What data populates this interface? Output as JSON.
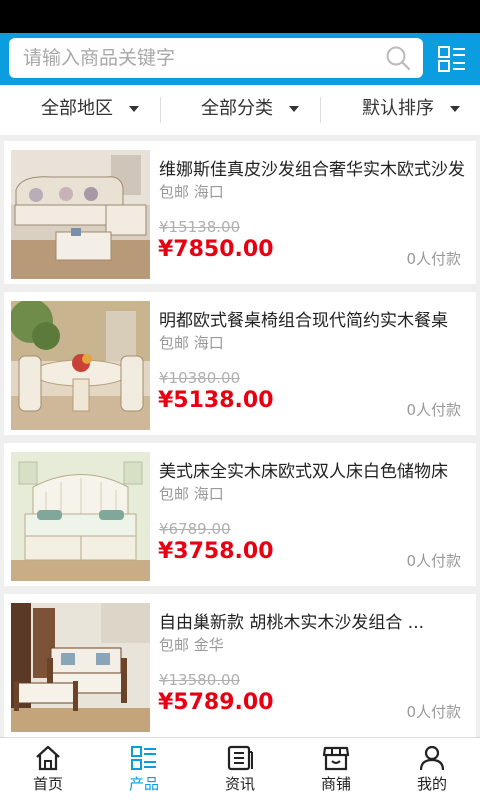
{
  "search": {
    "placeholder": "请输入商品关键字"
  },
  "filters": [
    "全部地区",
    "全部分类",
    "默认排序"
  ],
  "products": [
    {
      "title": "维娜斯佳真皮沙发组合奢华实木欧式沙发",
      "shipping": "包邮 海口",
      "original_price": "¥15138.00",
      "price": "¥7850.00",
      "sales": "0人付款",
      "image": "sofa-l-shape"
    },
    {
      "title": "明都欧式餐桌椅组合现代简约实木餐桌",
      "shipping": "包邮 海口",
      "original_price": "¥10380.00",
      "price": "¥5138.00",
      "sales": "0人付款",
      "image": "dining-set"
    },
    {
      "title": "美式床全实木床欧式双人床白色储物床",
      "shipping": "包邮 海口",
      "original_price": "¥6789.00",
      "price": "¥3758.00",
      "sales": "0人付款",
      "image": "bed"
    },
    {
      "title": "自由巢新款 胡桃木实木沙发组合 ...",
      "shipping": "包邮 金华",
      "original_price": "¥13580.00",
      "price": "¥5789.00",
      "sales": "0人付款",
      "image": "wood-sofa"
    }
  ],
  "tabs": [
    {
      "label": "首页",
      "icon": "home-icon",
      "active": false
    },
    {
      "label": "产品",
      "icon": "products-icon",
      "active": true
    },
    {
      "label": "资讯",
      "icon": "news-icon",
      "active": false
    },
    {
      "label": "商铺",
      "icon": "store-icon",
      "active": false
    },
    {
      "label": "我的",
      "icon": "user-icon",
      "active": false
    }
  ],
  "colors": {
    "accent": "#0a9ee0",
    "price": "#e60012"
  }
}
